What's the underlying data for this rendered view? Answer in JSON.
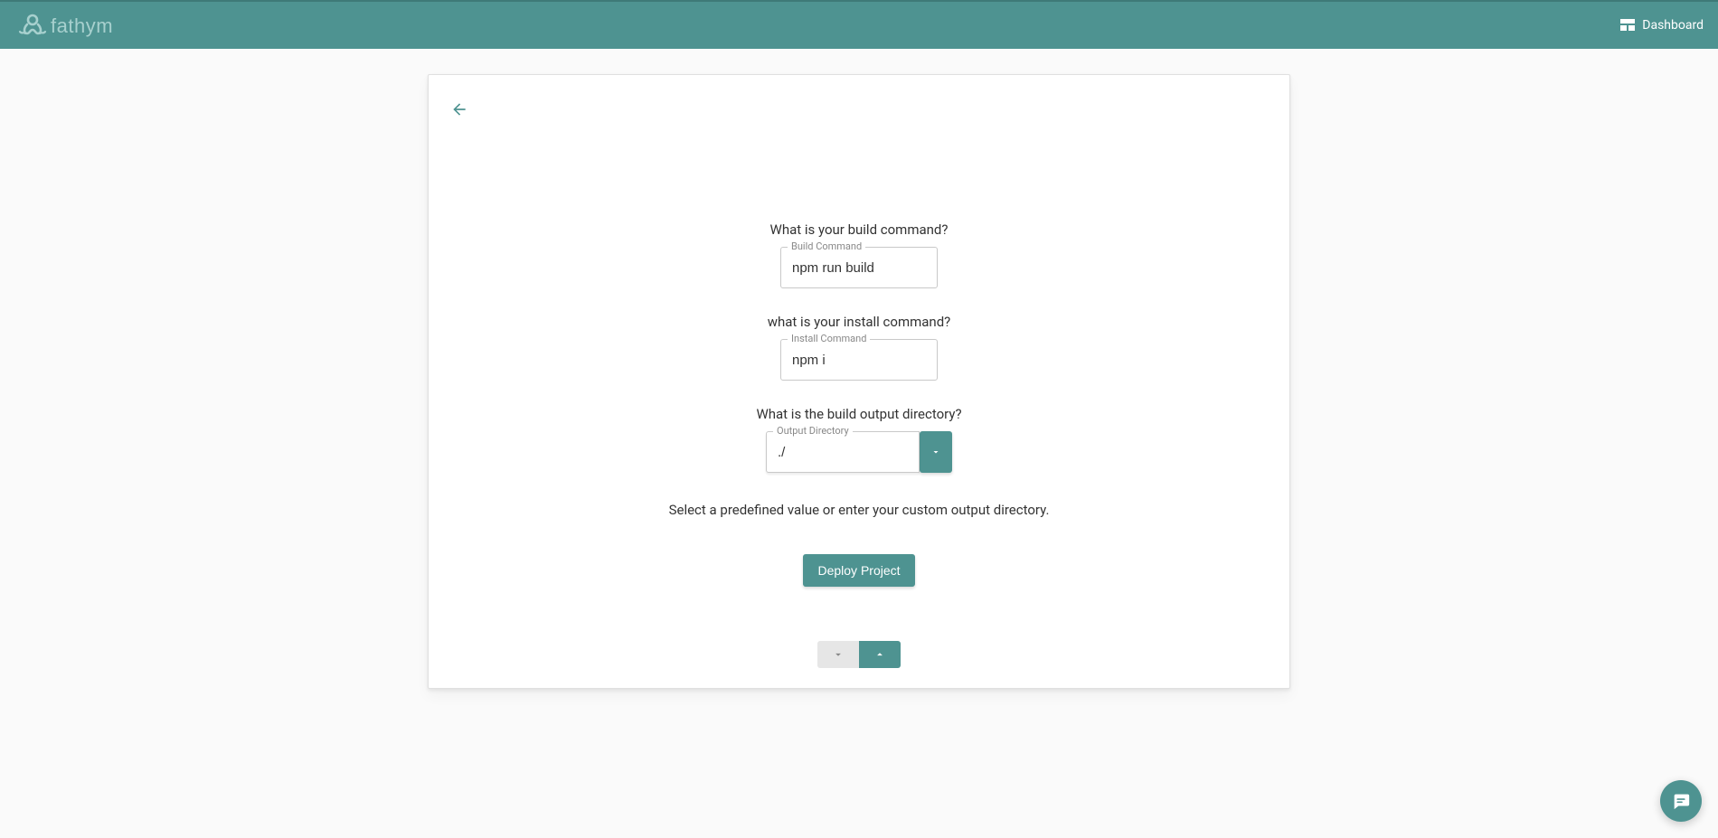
{
  "header": {
    "brand": "fathym",
    "dashboard_label": "Dashboard"
  },
  "form": {
    "q_build": "What is your build command?",
    "build_label": "Build Command",
    "build_value": "npm run build",
    "q_install": "what is your install command?",
    "install_label": "Install Command",
    "install_value": "npm i",
    "q_output": "What is the build output directory?",
    "output_label": "Output Directory",
    "output_value": "./",
    "helper": "Select a predefined value or enter your custom output directory.",
    "deploy_label": "Deploy Project"
  }
}
